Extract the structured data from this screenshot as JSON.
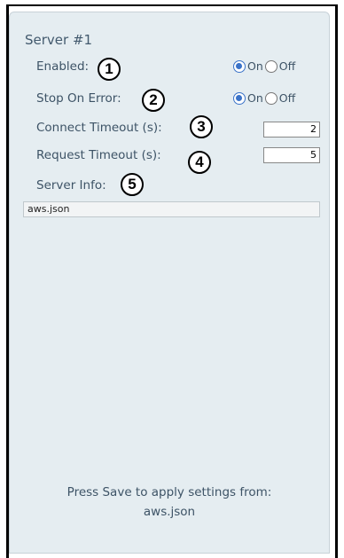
{
  "panel": {
    "title": "Server #1",
    "fields": {
      "enabled": {
        "label": "Enabled:",
        "badge": "1",
        "on_label": "On",
        "off_label": "Off",
        "value": "On"
      },
      "stop_on_error": {
        "label": "Stop On Error:",
        "badge": "2",
        "on_label": "On",
        "off_label": "Off",
        "value": "On"
      },
      "connect_timeout": {
        "label": "Connect Timeout (s):",
        "badge": "3",
        "value": "2"
      },
      "request_timeout": {
        "label": "Request Timeout (s):",
        "badge": "4",
        "value": "5"
      },
      "server_info": {
        "label": "Server Info:",
        "badge": "5",
        "value": "aws.json"
      }
    },
    "footer": {
      "line1": "Press Save to apply settings from:",
      "line2": "aws.json"
    }
  }
}
